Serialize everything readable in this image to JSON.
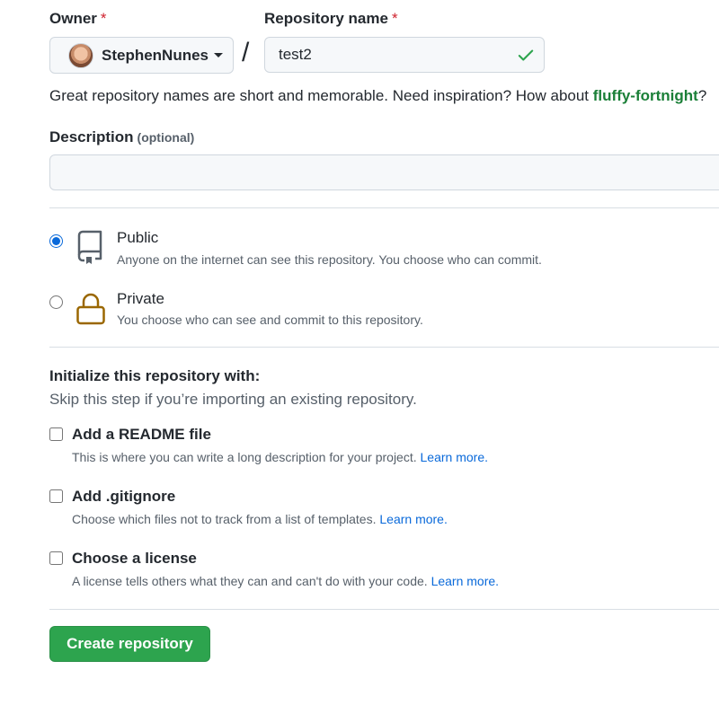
{
  "owner": {
    "label": "Owner",
    "required_mark": "*",
    "selected": "StephenNunes"
  },
  "separator": "/",
  "repo_name": {
    "label": "Repository name",
    "required_mark": "*",
    "value": "test2"
  },
  "name_hint": {
    "text": "Great repository names are short and memorable. Need inspiration? How about ",
    "suggestion": "fluffy-fortnight",
    "end": "?"
  },
  "description": {
    "label": "Description",
    "optional": "(optional)",
    "value": ""
  },
  "visibility": {
    "options": [
      {
        "title": "Public",
        "desc": "Anyone on the internet can see this repository. You choose who can commit.",
        "selected": true,
        "icon": "repo-icon"
      },
      {
        "title": "Private",
        "desc": "You choose who can see and commit to this repository.",
        "selected": false,
        "icon": "lock-icon"
      }
    ]
  },
  "init": {
    "title": "Initialize this repository with:",
    "subtitle": "Skip this step if you’re importing an existing repository.",
    "options": [
      {
        "title": "Add a README file",
        "desc": "This is where you can write a long description for your project. ",
        "link": "Learn more."
      },
      {
        "title": "Add .gitignore",
        "desc": "Choose which files not to track from a list of templates. ",
        "link": "Learn more."
      },
      {
        "title": "Choose a license",
        "desc": "A license tells others what they can and can't do with your code. ",
        "link": "Learn more."
      }
    ]
  },
  "submit_label": "Create repository",
  "colors": {
    "primary_green": "#2da44e",
    "link_blue": "#0969da",
    "suggestion_green": "#1a7f37",
    "required_red": "#cf222e",
    "lock_gold": "#9a6700"
  }
}
